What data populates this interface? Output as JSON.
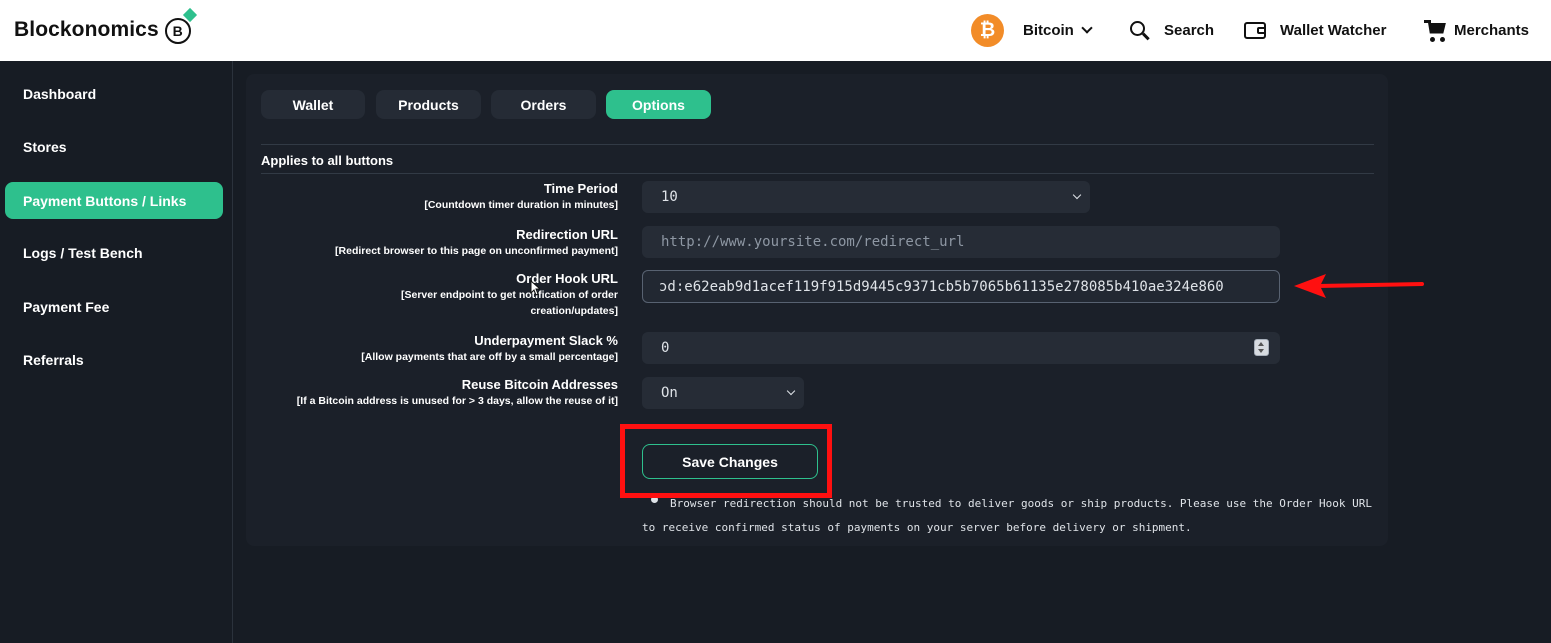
{
  "brand": {
    "name": "Blockonomics",
    "mark_letter": "B"
  },
  "topnav": {
    "coin_symbol": "₿",
    "coin_label": "Bitcoin",
    "search_label": "Search",
    "wallet_watcher_label": "Wallet Watcher",
    "merchants_label": "Merchants"
  },
  "sidebar": {
    "items": [
      {
        "label": "Dashboard"
      },
      {
        "label": "Stores"
      },
      {
        "label": "Payment Buttons / Links",
        "active": true
      },
      {
        "label": "Logs / Test Bench"
      },
      {
        "label": "Payment Fee"
      },
      {
        "label": "Referrals"
      }
    ]
  },
  "tabs": [
    {
      "label": "Wallet"
    },
    {
      "label": "Products"
    },
    {
      "label": "Orders"
    },
    {
      "label": "Options",
      "active": true
    }
  ],
  "section_title": "Applies to all buttons",
  "form": {
    "time_period": {
      "label": "Time Period",
      "hint": "[Countdown timer duration in minutes]",
      "value": "10"
    },
    "redirection_url": {
      "label": "Redirection URL",
      "hint": "[Redirect browser to this page on unconfirmed payment]",
      "placeholder": "http://www.yoursite.com/redirect_url"
    },
    "order_hook_url": {
      "label": "Order Hook URL",
      "hint": "[Server endpoint to get notification of order creation/updates]",
      "value": "ɔd:e62eab9d1acef119f915d9445c9371cb5b7065b61135e278085b410ae324e860"
    },
    "underpayment_slack": {
      "label": "Underpayment Slack %",
      "hint": "[Allow payments that are off by a small percentage]",
      "value": "0"
    },
    "reuse_addresses": {
      "label": "Reuse Bitcoin Addresses",
      "hint": "[If a Bitcoin address is unused for > 3 days, allow the reuse of it]",
      "value": "On"
    }
  },
  "save_label": "Save Changes",
  "note": "Browser redirection should not be trusted to deliver goods or ship products. Please use the Order Hook URL to receive confirmed status of payments on your server before delivery or shipment.",
  "colors": {
    "accent": "#2ec08d",
    "annotation": "#ff1010",
    "bitcoin": "#f28c28",
    "background": "#171c24"
  }
}
